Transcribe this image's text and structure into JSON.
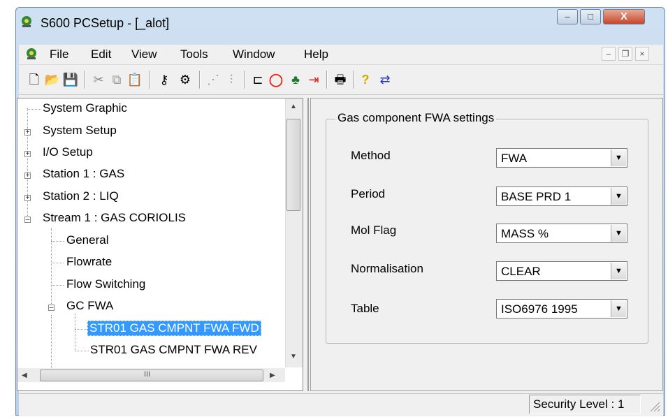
{
  "window": {
    "title": "S600 PCSetup - [_alot]",
    "app_icon": "pcsetup-app-icon"
  },
  "title_controls": {
    "minimize": "–",
    "maximize": "□",
    "close": "X"
  },
  "menu": {
    "items": [
      "File",
      "Edit",
      "View",
      "Tools",
      "Window",
      "Help"
    ],
    "mdi_controls": [
      "–",
      "❐",
      "×"
    ]
  },
  "toolbar": {
    "icons": [
      "new-file-icon",
      "open-folder-icon",
      "save-icon",
      "cut-icon",
      "copy-icon",
      "paste-icon",
      "key-icon",
      "connect-icon",
      "network-icon",
      "sliders-icon",
      "module-icon",
      "ring-icon",
      "tree-icon",
      "split-icon",
      "print-icon",
      "help-icon",
      "transfer-icon"
    ]
  },
  "tree": {
    "items": [
      {
        "label": "System Graphic"
      },
      {
        "label": "System Setup",
        "expander": "+"
      },
      {
        "label": "I/O Setup",
        "expander": "+"
      },
      {
        "label": "Station 1 : GAS",
        "expander": "+"
      },
      {
        "label": "Station 2 : LIQ",
        "expander": "+"
      },
      {
        "label": "Stream 1 : GAS CORIOLIS",
        "expander": "–"
      },
      {
        "label": "General"
      },
      {
        "label": "Flowrate"
      },
      {
        "label": "Flow Switching"
      },
      {
        "label": "GC FWA",
        "expander": "–"
      },
      {
        "label": "STR01 GAS CMPNT FWA FWD",
        "selected": true
      },
      {
        "label": "STR01 GAS CMPNT FWA REV"
      }
    ]
  },
  "scroll": {
    "h_thumb_grip": "III"
  },
  "panel": {
    "group_title": "Gas component FWA settings",
    "fields": [
      {
        "label": "Method",
        "value": "FWA"
      },
      {
        "label": "Period",
        "value": "BASE PRD 1"
      },
      {
        "label": "Mol Flag",
        "value": "MASS %"
      },
      {
        "label": "Normalisation",
        "value": "CLEAR"
      },
      {
        "label": "Table",
        "value": "ISO6976 1995"
      }
    ]
  },
  "status": {
    "security": "Security Level : 1"
  }
}
